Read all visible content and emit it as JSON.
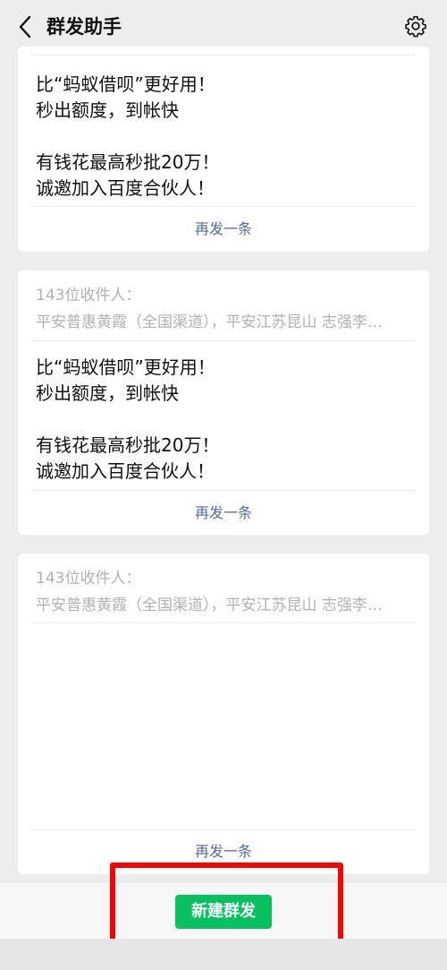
{
  "header": {
    "title": "群发助手",
    "back_icon": "chevron-left-icon",
    "settings_icon": "gear-icon"
  },
  "cards": [
    {
      "recipients_count": "",
      "recipients_names": "",
      "message": "比“蚂蚁借呗”更好用！\n秒出额度，到帐快\n\n有钱花最高秒批20万！\n诚邀加入百度合伙人！",
      "resend_label": "再发一条"
    },
    {
      "recipients_count": "143位收件人：",
      "recipients_names": "平安普惠黄霞（全国渠道），平安江苏昆山 志强李…",
      "message": "比“蚂蚁借呗”更好用！\n秒出额度，到帐快\n\n有钱花最高秒批20万！\n诚邀加入百度合伙人！",
      "resend_label": "再发一条"
    },
    {
      "recipients_count": "143位收件人：",
      "recipients_names": "平安普惠黄霞（全国渠道），平安江苏昆山 志强李…",
      "message": "",
      "resend_label": "再发一条"
    }
  ],
  "bottom": {
    "new_broadcast_label": "新建群发"
  },
  "colors": {
    "accent_green": "#07c160",
    "link_blue": "#576b95",
    "highlight_red": "#ff0000"
  }
}
